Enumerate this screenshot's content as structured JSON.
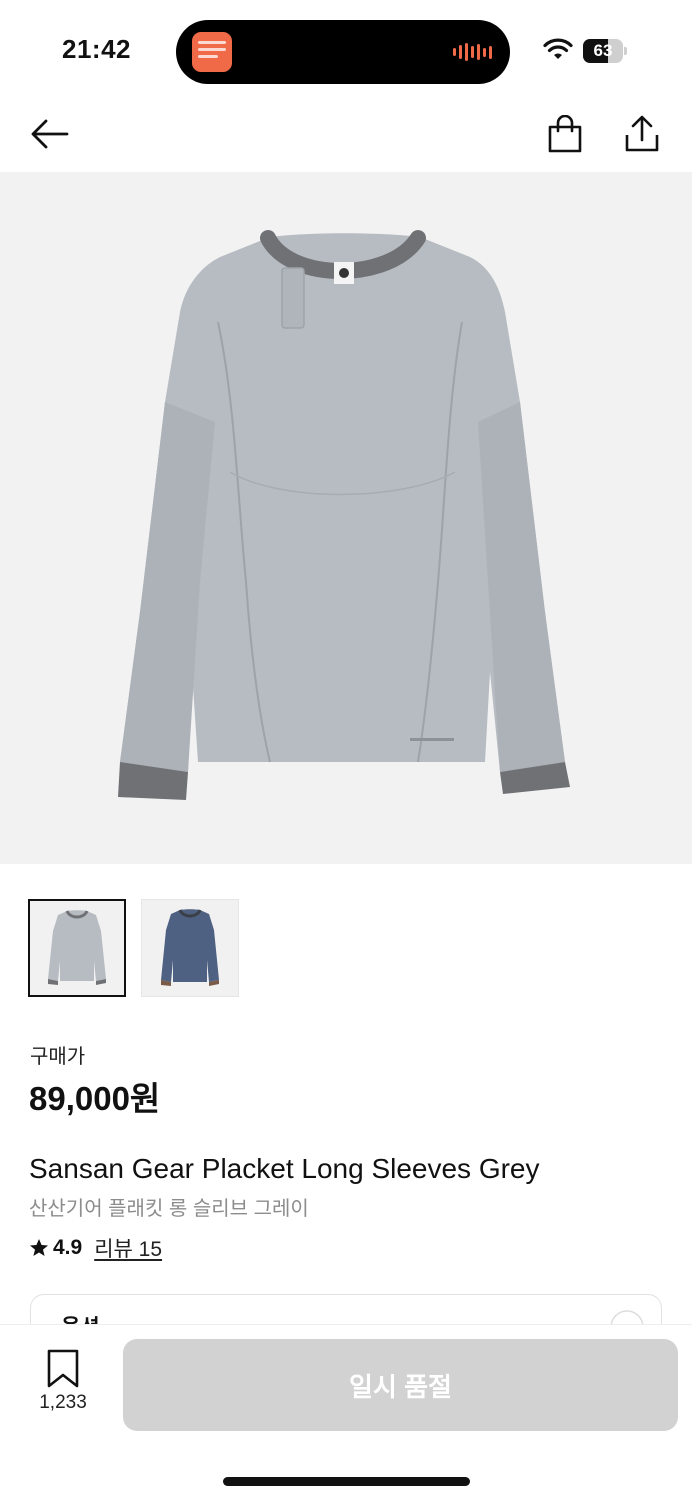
{
  "status_bar": {
    "time": "21:42",
    "battery_percent": 63,
    "battery_label": "63",
    "icons": [
      "app-activity-icon",
      "audio-wave-icon",
      "wifi-icon",
      "battery-icon"
    ]
  },
  "nav": {
    "back_icon": "arrow-left-icon",
    "cart_icon": "shopping-bag-icon",
    "share_icon": "share-icon"
  },
  "gallery": {
    "main_image": "product-photo-grey-long-sleeve",
    "thumbnails": [
      {
        "name": "grey-long-sleeve",
        "selected": true
      },
      {
        "name": "navy-long-sleeve",
        "selected": false
      }
    ]
  },
  "product": {
    "price_label": "구매가",
    "price": "89,000원",
    "title_en": "Sansan Gear Placket Long Sleeves Grey",
    "title_ko": "산산기어 플래킷 롱 슬리브 그레이",
    "rating": "4.9",
    "reviews_label": "리뷰 15"
  },
  "options": {
    "label": "옵션"
  },
  "bottom_bar": {
    "bookmark_count": "1,233",
    "soldout_label": "일시 품절"
  },
  "colors": {
    "sweater_grey": "#b7bcc2",
    "trim_grey": "#6f7175",
    "navy": "#4e6182",
    "disabled_button": "#d2d2d2"
  }
}
